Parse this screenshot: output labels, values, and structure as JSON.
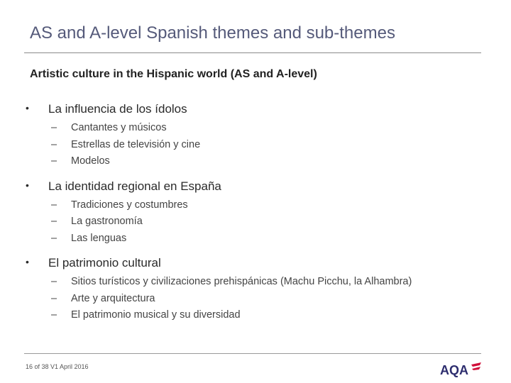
{
  "slide": {
    "title": "AS and A-level Spanish themes and sub-themes",
    "subtitle": "Artistic culture in the Hispanic world  (AS and A-level)"
  },
  "topics": [
    {
      "bullet": "•",
      "label": "La influencia de los ídolos",
      "subtopics": [
        {
          "dash": "–",
          "label": "Cantantes y músicos"
        },
        {
          "dash": "–",
          "label": "Estrellas de televisión y cine"
        },
        {
          "dash": "–",
          "label": "Modelos"
        }
      ]
    },
    {
      "bullet": "•",
      "label": "La identidad regional en España",
      "subtopics": [
        {
          "dash": "–",
          "label": "Tradiciones y costumbres"
        },
        {
          "dash": "–",
          "label": "La gastronomía"
        },
        {
          "dash": "–",
          "label": "Las lenguas"
        }
      ]
    },
    {
      "bullet": "•",
      "label": "El patrimonio cultural",
      "subtopics": [
        {
          "dash": "–",
          "label": "Sitios turísticos y civilizaciones prehispánicas (Machu Picchu, la Alhambra)"
        },
        {
          "dash": "–",
          "label": "Arte y arquitectura"
        },
        {
          "dash": "–",
          "label": "El patrimonio musical y su diversidad"
        }
      ]
    }
  ],
  "footer": {
    "page_info": "16 of 38 V1 April 2016",
    "logo_text": "AQA",
    "logo_icon": "aqa-logo-swoosh-icon",
    "brand_color": "#2d2d6e",
    "accent_color": "#d0103a"
  }
}
